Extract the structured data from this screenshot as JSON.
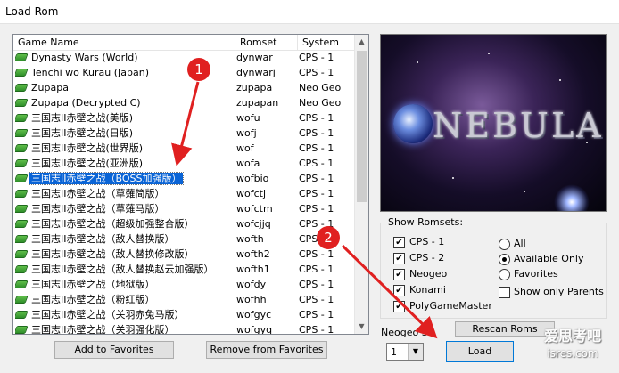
{
  "window": {
    "title": "Load Rom"
  },
  "list": {
    "headers": {
      "name": "Game Name",
      "romset": "Romset",
      "system": "System"
    },
    "selected_index": 8,
    "rows": [
      {
        "name": "Dynasty Wars (World)",
        "romset": "dynwar",
        "system": "CPS - 1"
      },
      {
        "name": "Tenchi wo Kurau (Japan)",
        "romset": "dynwarj",
        "system": "CPS - 1"
      },
      {
        "name": "Zupapa",
        "romset": "zupapa",
        "system": "Neo Geo"
      },
      {
        "name": "Zupapa (Decrypted C)",
        "romset": "zupapan",
        "system": "Neo Geo"
      },
      {
        "name": "三国志II赤壁之战(美版)",
        "romset": "wofu",
        "system": "CPS - 1"
      },
      {
        "name": "三国志II赤壁之战(日版)",
        "romset": "wofj",
        "system": "CPS - 1"
      },
      {
        "name": "三国志II赤壁之战(世界版)",
        "romset": "wof",
        "system": "CPS - 1"
      },
      {
        "name": "三国志II赤壁之战(亚洲版)",
        "romset": "wofa",
        "system": "CPS - 1"
      },
      {
        "name": "三国志II赤壁之战（BOSS加强版）",
        "romset": "wofbio",
        "system": "CPS - 1"
      },
      {
        "name": "三国志II赤壁之战（草薙简版）",
        "romset": "wofctj",
        "system": "CPS - 1"
      },
      {
        "name": "三国志II赤壁之战（草薙马版）",
        "romset": "wofctm",
        "system": "CPS - 1"
      },
      {
        "name": "三国志II赤壁之战（超级加强整合版）",
        "romset": "wofcjjq",
        "system": "CPS - 1"
      },
      {
        "name": "三国志II赤壁之战（敌人替换版）",
        "romset": "wofth",
        "system": "CPS - 1"
      },
      {
        "name": "三国志II赤壁之战（敌人替换修改版）",
        "romset": "wofth2",
        "system": "CPS - 1"
      },
      {
        "name": "三国志II赤壁之战（敌人替换赵云加强版）",
        "romset": "wofth1",
        "system": "CPS - 1"
      },
      {
        "name": "三国志II赤壁之战（地狱版）",
        "romset": "wofdy",
        "system": "CPS - 1"
      },
      {
        "name": "三国志II赤壁之战（粉红版）",
        "romset": "wofhh",
        "system": "CPS - 1"
      },
      {
        "name": "三国志II赤壁之战（关羽赤兔马版）",
        "romset": "wofgyc",
        "system": "CPS - 1"
      },
      {
        "name": "三国志II赤壁之战（关羽强化版）",
        "romset": "wofgyq",
        "system": "CPS - 1"
      }
    ]
  },
  "buttons": {
    "add_favorites": "Add to Favorites",
    "remove_favorites": "Remove from Favorites",
    "rescan": "Rescan Roms",
    "load": "Load"
  },
  "preview": {
    "logo_text": "NEBULA"
  },
  "show_romsets": {
    "label": "Show Romsets:",
    "systems": [
      {
        "label": "CPS - 1",
        "checked": true
      },
      {
        "label": "CPS - 2",
        "checked": true
      },
      {
        "label": "Neogeo",
        "checked": true
      },
      {
        "label": "Konami",
        "checked": true
      },
      {
        "label": "PolyGameMaster",
        "checked": true
      }
    ],
    "filters": [
      {
        "label": "All",
        "selected": false
      },
      {
        "label": "Available Only",
        "selected": true
      },
      {
        "label": "Favorites",
        "selected": false
      }
    ],
    "parents_only": {
      "label": "Show only Parents",
      "checked": false
    }
  },
  "neogeo": {
    "label": "Neogeo Sl",
    "value": "1"
  },
  "annotations": {
    "marker1": "1",
    "marker2": "2",
    "color": "#e02020"
  },
  "watermark": {
    "line1": "爱思考吧",
    "line2": "isres.com"
  }
}
